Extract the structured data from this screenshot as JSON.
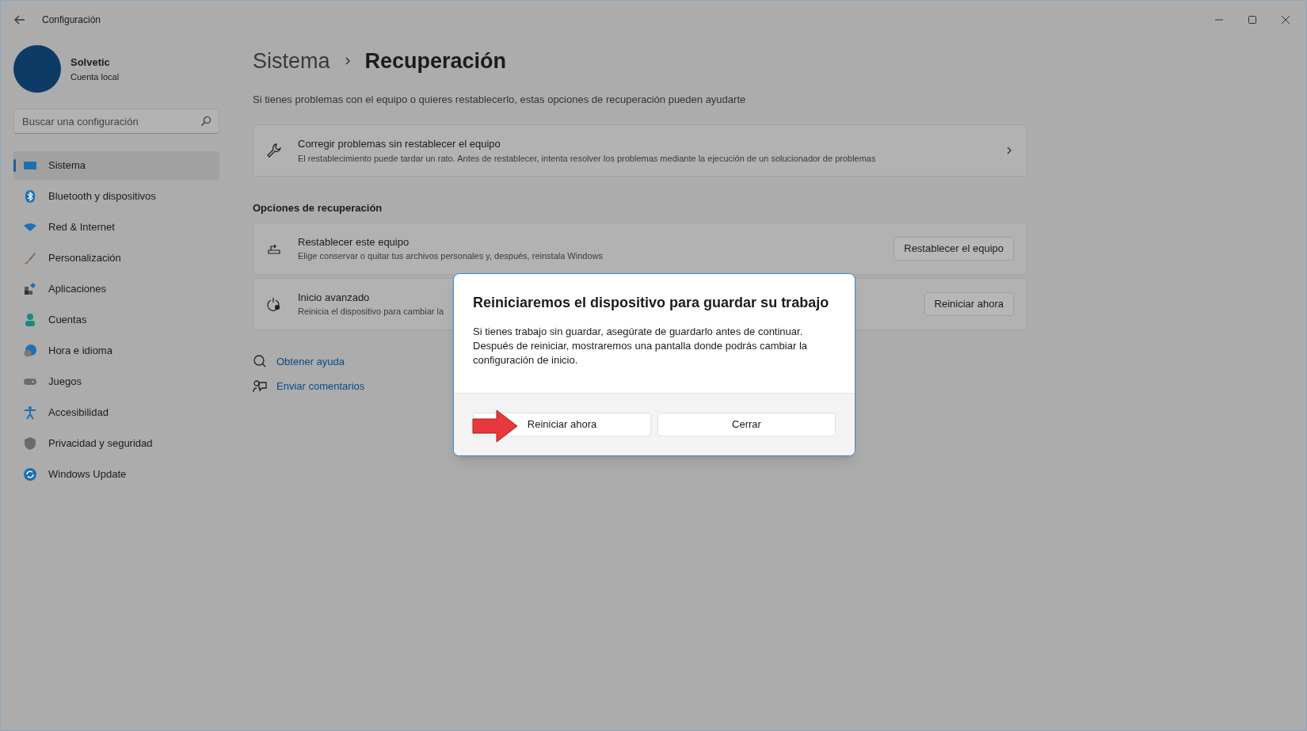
{
  "window": {
    "title": "Configuración"
  },
  "account": {
    "name": "Solvetic",
    "type": "Cuenta local"
  },
  "search": {
    "placeholder": "Buscar una configuración"
  },
  "sidebar": {
    "items": [
      {
        "label": "Sistema",
        "kind": "system",
        "selected": true
      },
      {
        "label": "Bluetooth y dispositivos",
        "kind": "bluetooth",
        "selected": false
      },
      {
        "label": "Red & Internet",
        "kind": "wifi",
        "selected": false
      },
      {
        "label": "Personalización",
        "kind": "brush",
        "selected": false
      },
      {
        "label": "Aplicaciones",
        "kind": "apps",
        "selected": false
      },
      {
        "label": "Cuentas",
        "kind": "person",
        "selected": false
      },
      {
        "label": "Hora e idioma",
        "kind": "globe",
        "selected": false
      },
      {
        "label": "Juegos",
        "kind": "gamepad",
        "selected": false
      },
      {
        "label": "Accesibilidad",
        "kind": "access",
        "selected": false
      },
      {
        "label": "Privacidad y seguridad",
        "kind": "shield",
        "selected": false
      },
      {
        "label": "Windows Update",
        "kind": "update",
        "selected": false
      }
    ]
  },
  "breadcrumb": [
    "Sistema",
    "Recuperación"
  ],
  "description": "Si tienes problemas con el equipo o quieres restablecerlo, estas opciones de recuperación pueden ayudarte",
  "fix_card": {
    "title": "Corregir problemas sin restablecer el equipo",
    "subtitle": "El restablecimiento puede tardar un rato. Antes de restablecer, intenta resolver los problemas mediante la ejecución de un solucionador de problemas"
  },
  "section_title": "Opciones de recuperación",
  "options": [
    {
      "kind": "reset",
      "title": "Restablecer este equipo",
      "subtitle": "Elige conservar o quitar tus archivos personales y, después, reinstala Windows",
      "button": "Restablecer el equipo"
    },
    {
      "kind": "advanced",
      "title": "Inicio avanzado",
      "subtitle": "Reinicia el dispositivo para cambiar la",
      "button": "Reiniciar ahora"
    }
  ],
  "links": [
    {
      "kind": "help",
      "label": "Obtener ayuda"
    },
    {
      "kind": "feedback",
      "label": "Enviar comentarios"
    }
  ],
  "dialog": {
    "title": "Reiniciaremos el dispositivo para guardar su trabajo",
    "body": "Si tienes trabajo sin guardar, asegúrate de guardarlo antes de continuar. Después de reiniciar, mostraremos una pantalla donde podrás cambiar la configuración de inicio.",
    "buttons": [
      "Reiniciar ahora",
      "Cerrar"
    ]
  }
}
